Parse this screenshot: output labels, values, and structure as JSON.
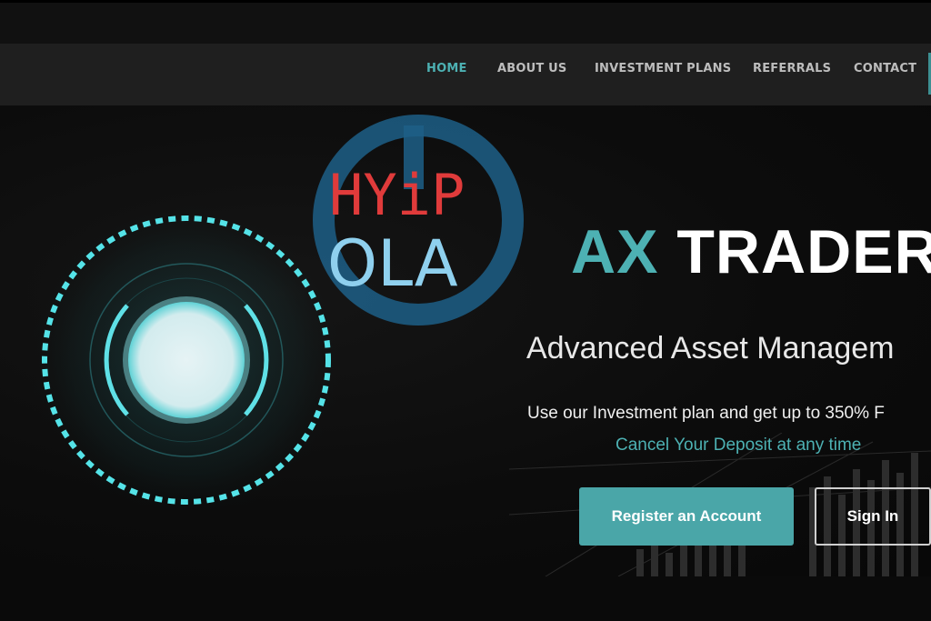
{
  "nav": {
    "items": [
      {
        "label": "HOME",
        "active": true
      },
      {
        "label": "ABOUT US",
        "active": false
      },
      {
        "label": "INVESTMENT PLANS",
        "active": false
      },
      {
        "label": "REFERRALS",
        "active": false
      },
      {
        "label": "CONTACT",
        "active": false
      }
    ]
  },
  "watermark": {
    "line1": "HYiP",
    "line2": "OLA",
    "colors": {
      "line1": "#e03b3b",
      "line2": "#8fd0ee",
      "ring": "#1d5f87"
    }
  },
  "hero": {
    "title_accent": "AX",
    "title_main": "TRADER",
    "subtitle": "Advanced Asset Managem",
    "tagline": "Use our Investment plan and get up to 350% F",
    "note": "Cancel Your Deposit at any time",
    "register_label": "Register an Account",
    "signin_label": "Sign In"
  },
  "colors": {
    "accent": "#4db1b3",
    "nav_bg": "#1f1f1f",
    "page_bg": "#0b0b0b",
    "button_primary": "#4aa6a8"
  },
  "icons": {
    "orb": "glowing-circle-icon"
  }
}
